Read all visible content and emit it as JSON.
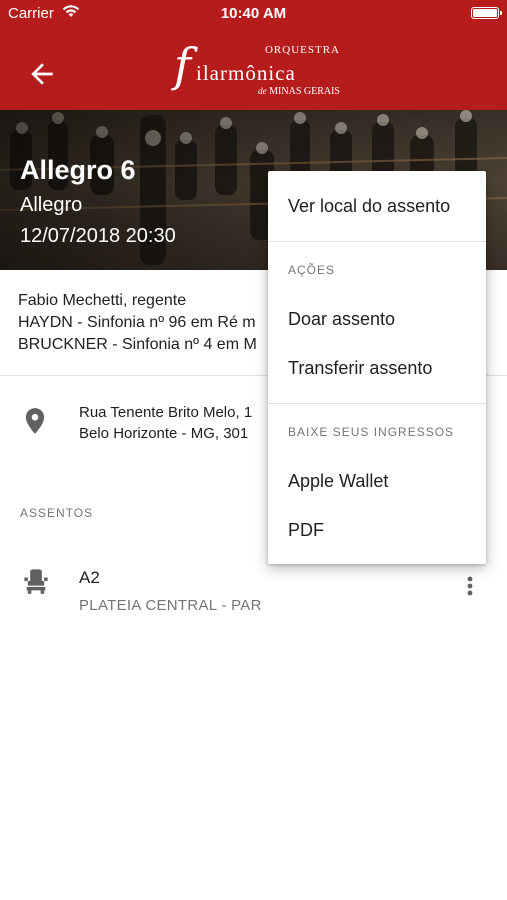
{
  "status_bar": {
    "carrier": "Carrier",
    "time": "10:40 AM"
  },
  "app_bar": {
    "logo": {
      "top": "ORQUESTRA",
      "main": "ilarmônica",
      "initial": "f",
      "sub_prefix": "de",
      "sub": "MINAS GERAIS"
    },
    "color": "#b71c1c"
  },
  "event": {
    "title": "Allegro 6",
    "subtitle": "Allegro",
    "datetime": "12/07/2018 20:30"
  },
  "program": [
    "Fabio Mechetti, regente",
    "HAYDN - Sinfonia nº 96 em Ré m",
    "BRUCKNER - Sinfonia nº 4 em M"
  ],
  "location": {
    "line1": "Rua Tenente Brito Melo, 1",
    "line2": "Belo Horizonte - MG, 301"
  },
  "seats": {
    "header": "ASSENTOS",
    "items": [
      {
        "code": "A2",
        "section": "PLATEIA CENTRAL - PAR"
      }
    ]
  },
  "menu": {
    "view_seat": "Ver local do assento",
    "actions_header": "AÇÕES",
    "donate": "Doar assento",
    "transfer": "Transferir assento",
    "download_header": "BAIXE SEUS INGRESSOS",
    "wallet": "Apple Wallet",
    "pdf": "PDF"
  }
}
